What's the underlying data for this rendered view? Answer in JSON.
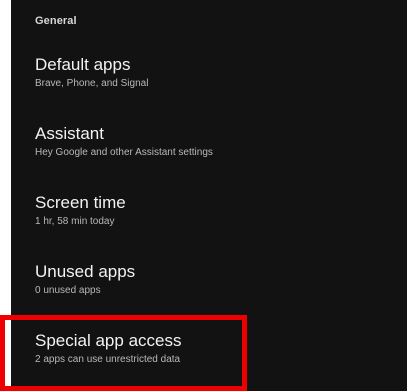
{
  "section": {
    "header": "General"
  },
  "items": [
    {
      "title": "Default apps",
      "summary": "Brave, Phone, and Signal"
    },
    {
      "title": "Assistant",
      "summary": "Hey Google and other Assistant settings"
    },
    {
      "title": "Screen time",
      "summary": "1 hr, 58 min today"
    },
    {
      "title": "Unused apps",
      "summary": "0 unused apps"
    },
    {
      "title": "Special app access",
      "summary": "2 apps can use unrestricted data"
    }
  ],
  "colors": {
    "background": "#121212",
    "title_text": "#f2f2f2",
    "summary_text": "#b8b8b8",
    "highlight": "#ee0000"
  }
}
